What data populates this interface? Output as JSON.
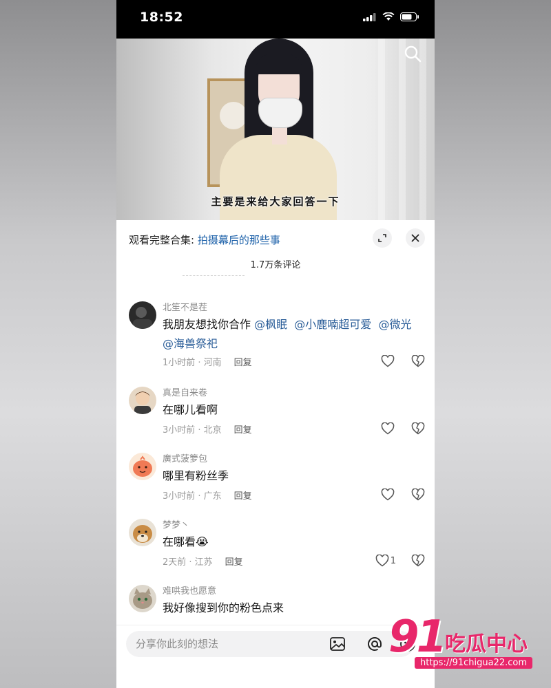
{
  "status": {
    "time": "18:52"
  },
  "video": {
    "subtitle": "主要是来给大家回答一下"
  },
  "sheet": {
    "collection_prefix": "观看完整合集: ",
    "collection_link": "拍摄幕后的那些事",
    "comment_count": "1.7万条评论"
  },
  "comments": [
    {
      "user": "北笙不是茬",
      "text_plain": "我朋友想找你合作 ",
      "mentions": [
        "@枫眠",
        "@小鹿喃超可爱",
        "@微光",
        "@海兽祭祀"
      ],
      "meta": "1小时前 · 河南",
      "reply": "回复",
      "likes": ""
    },
    {
      "user": "真是自来卷",
      "text": "在哪儿看啊",
      "meta": "3小时前 · 北京",
      "reply": "回复",
      "likes": ""
    },
    {
      "user": "廣式菠箩包",
      "text": "哪里有粉丝季",
      "meta": "3小时前 · 广东",
      "reply": "回复",
      "likes": ""
    },
    {
      "user": "梦梦丶",
      "text": "在哪看😭",
      "meta": "2天前 · 江苏",
      "reply": "回复",
      "likes": "1"
    },
    {
      "user": "难哄我也愿意",
      "text": "我好像搜到你的粉色点来",
      "meta": "",
      "reply": "",
      "likes": ""
    }
  ],
  "composer": {
    "placeholder": "分享你此刻的想法"
  },
  "watermark": {
    "logo_number": "91",
    "logo_text": "吃瓜中心",
    "url": "https://91chigua22.com"
  },
  "colors": {
    "link": "#1a5fa8",
    "mention": "#2a5d98",
    "watermark": "#e8276a"
  }
}
